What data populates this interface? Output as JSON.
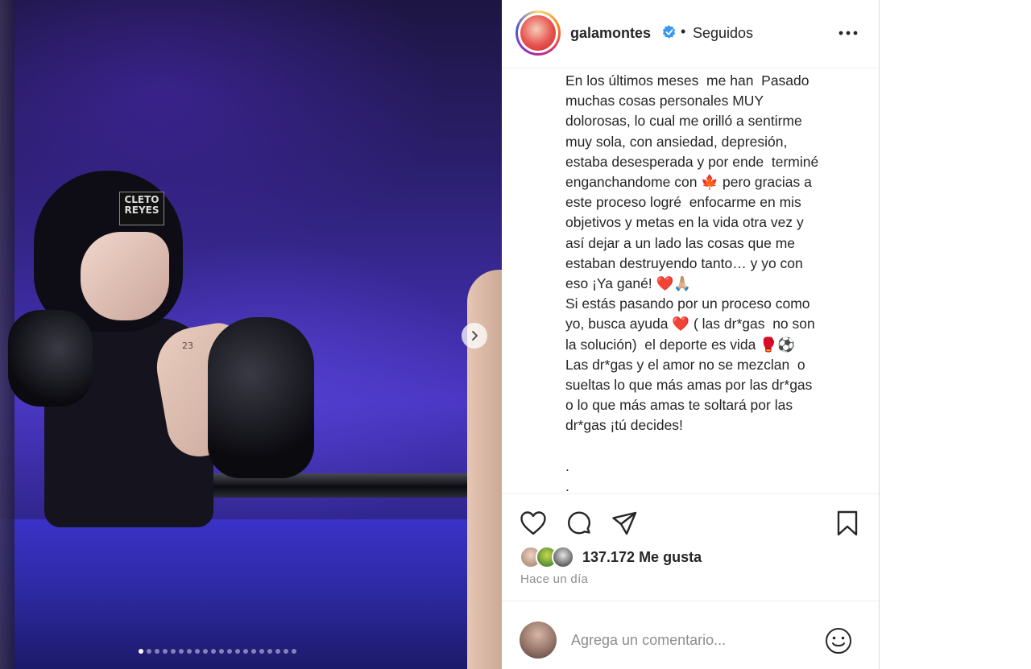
{
  "photo": {
    "brand_patch": "CLETO REYES",
    "tattoo": "23",
    "dots_count": 20,
    "active_dot": 0
  },
  "header": {
    "username": "galamontes",
    "separator": "•",
    "follow_status": "Seguidos",
    "more_label": "•••"
  },
  "caption": {
    "text": "En los últimos meses  me han  Pasado\nmuchas cosas personales MUY\ndolorosas, lo cual me orilló a sentirme\nmuy sola, con ansiedad, depresión,\nestaba desesperada y por ende  terminé\nenganchandome con 🍁 pero gracias a\neste proceso logré  enfocarme en mis\nobjetivos y metas en la vida otra vez y\nasí dejar a un lado las cosas que me\nestaban destruyendo tanto… y yo con\neso ¡Ya gané! ❤️🙏🏼\nSi estás pasando por un proceso como\nyo, busca ayuda ❤️ ( las dr*gas  no son\nla solución)  el deporte es vida 🥊⚽\nLas dr*gas y el amor no se mezclan  o\nsueltas lo que más amas por las dr*gas\no lo que más amas te soltará por las\ndr*gas ¡tú decides!\n\n.\n."
  },
  "stats": {
    "likes": "137.172 Me gusta",
    "time_ago": "Hace un día"
  },
  "comment": {
    "placeholder": "Agrega un comentario..."
  },
  "colors": {
    "verified": "#3897f0",
    "text": "#262626",
    "muted": "#8e8e8e",
    "border": "#efefef"
  },
  "icons": [
    "chevron-right-icon",
    "verified-badge-icon",
    "more-options-icon",
    "heart-icon",
    "comment-icon",
    "share-icon",
    "bookmark-icon",
    "emoji-icon"
  ]
}
